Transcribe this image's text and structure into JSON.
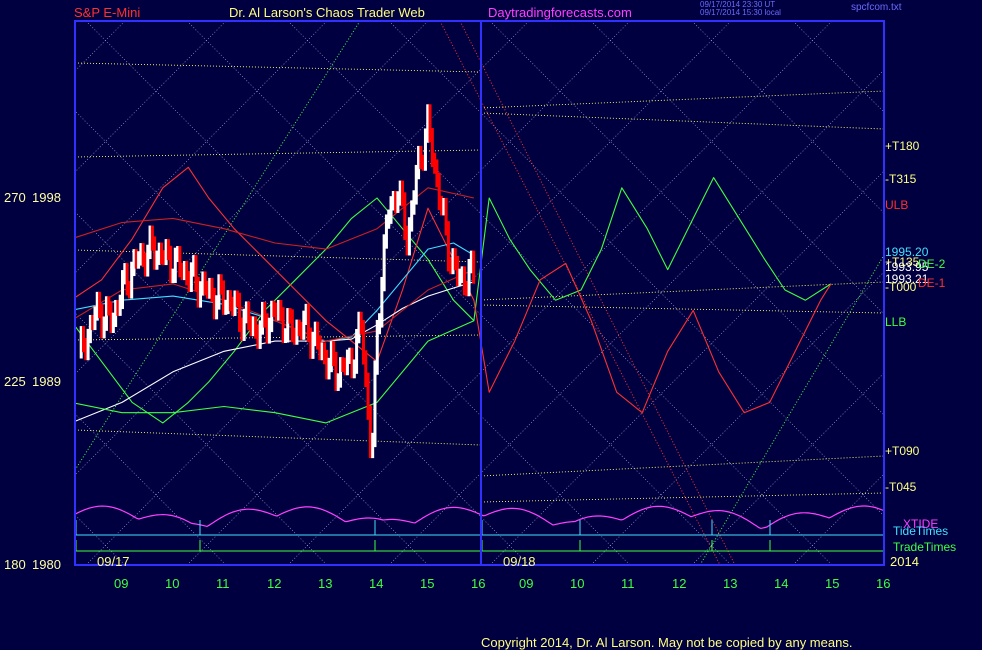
{
  "header": {
    "instrument": "S&P E-Mini",
    "site": "Dr. Al Larson's Chaos Trader Web",
    "link": "Daytradingforecasts.com",
    "ts1": "09/17/2014 23:30 UT",
    "ts2": "09/17/2014 15:30 local",
    "file": "spcfcom.txt"
  },
  "copyright": "Copyright 2014, Dr. Al Larson. May not be copied by any means.",
  "colors": {
    "background": "#000040",
    "frame": "#3030ff",
    "price_up": "#ffffff",
    "price_down": "#ff0000"
  },
  "chart_data": {
    "type": "line",
    "title": "S&P E-Mini",
    "y_axis_labels": [
      {
        "deg": "270",
        "price": "1998"
      },
      {
        "deg": "225",
        "price": "1989"
      },
      {
        "deg": "180",
        "price": "1980"
      }
    ],
    "x_tick_labels_day1": [
      "09",
      "10",
      "11",
      "12",
      "13",
      "14",
      "15",
      "16"
    ],
    "x_tick_labels_day2": [
      "09",
      "10",
      "11",
      "12",
      "13",
      "14",
      "15",
      "16"
    ],
    "date_labels": {
      "day1": "09/17",
      "day2": "09/18",
      "year": "2014"
    },
    "level_labels": [
      {
        "text": "+T180",
        "color": "#ffff80",
        "price": 2000.5
      },
      {
        "text": "-T315",
        "color": "#ffff80",
        "price": 1998.9
      },
      {
        "text": "ULB",
        "color": "#ff3030",
        "price": 1997.6
      },
      {
        "text": "1995.20",
        "color": "#40e0ff",
        "price": 1995.3
      },
      {
        "text": "+T135",
        "color": "#ffff80",
        "price": 1994.8
      },
      {
        "text": "1993.95",
        "color": "#ffffff",
        "price": 1994.6
      },
      {
        "text": "DE-2",
        "color": "#40ff40",
        "price": 1994.7
      },
      {
        "text": "1993.21",
        "color": "#ffffff",
        "price": 1994.0
      },
      {
        "text": "DE-1",
        "color": "#ff3030",
        "price": 1993.8
      },
      {
        "text": "-T000",
        "color": "#ffff80",
        "price": 1993.6
      },
      {
        "text": "LLB",
        "color": "#40ff40",
        "price": 1991.9
      },
      {
        "text": "+T090",
        "color": "#ffff80",
        "price": 1985.6
      },
      {
        "text": "-T045",
        "color": "#ffff80",
        "price": 1983.8
      }
    ],
    "legend": [
      "XTIDE",
      "TideTimes",
      "TradeTimes"
    ],
    "series": [
      {
        "name": "Price",
        "color": "#ffffff",
        "x": [
          8.2,
          8.5,
          8.8,
          9.0,
          9.3,
          9.6,
          9.9,
          10.2,
          10.5,
          10.8,
          11.1,
          11.4,
          11.7,
          12.0,
          12.3,
          12.6,
          12.9,
          13.2,
          13.5,
          13.7,
          13.9,
          14.0,
          14.2,
          14.4,
          14.6,
          14.8,
          15.0,
          15.2,
          15.4,
          15.6,
          15.9
        ],
        "y": [
          1990.5,
          1992.5,
          1992.0,
          1993.5,
          1995.0,
          1995.5,
          1995.0,
          1994.5,
          1993.8,
          1993.2,
          1993.0,
          1992.0,
          1991.5,
          1992.5,
          1991.5,
          1991.8,
          1990.5,
          1989.5,
          1990.0,
          1991.8,
          1985.0,
          1991.5,
          1997.0,
          1998.5,
          1996.0,
          1999.5,
          2001.5,
          1998.5,
          1995.5,
          1994.0,
          1994.3
        ]
      },
      {
        "name": "DE-2",
        "color": "#40ff40",
        "x": [
          8.0,
          8.6,
          9.2,
          9.8,
          10.3,
          10.7,
          11.2,
          11.8,
          12.4,
          13.0,
          13.5,
          14.0,
          14.5,
          15.0,
          15.5,
          15.9,
          16.2,
          16.6,
          17.0,
          17.5,
          18.0,
          18.4,
          18.8,
          19.3,
          19.7,
          20.2,
          20.6,
          21.1,
          21.6,
          22.0,
          22.4,
          22.9
        ],
        "y": [
          1992.0,
          1990.0,
          1988.0,
          1987.0,
          1988.0,
          1989.0,
          1990.5,
          1992.5,
          1994.0,
          1995.5,
          1997.0,
          1998.0,
          1996.5,
          1995.0,
          1993.0,
          1992.0,
          1998.0,
          1996.0,
          1994.5,
          1993.0,
          1993.5,
          1995.5,
          1998.5,
          1996.5,
          1994.5,
          1997.0,
          1999.0,
          1997.0,
          1995.0,
          1993.5,
          1993.0,
          1993.8
        ]
      },
      {
        "name": "DE-1",
        "color": "#ff3030",
        "x": [
          8.0,
          8.6,
          9.2,
          9.8,
          10.3,
          10.7,
          11.2,
          11.8,
          12.4,
          13.0,
          13.5,
          14.0,
          14.5,
          15.0,
          15.5,
          15.9,
          16.2,
          16.7,
          17.2,
          17.7,
          18.2,
          18.7,
          19.2,
          19.7,
          20.2,
          20.7,
          21.2,
          21.7,
          22.2,
          22.7,
          22.9
        ],
        "y": [
          1993.0,
          1994.0,
          1996.0,
          1998.5,
          1999.5,
          1998.0,
          1996.5,
          1995.0,
          1993.5,
          1992.0,
          1991.0,
          1990.0,
          1993.5,
          1997.5,
          1995.0,
          1993.0,
          1988.5,
          1991.0,
          1994.0,
          1994.8,
          1992.0,
          1988.5,
          1987.5,
          1990.5,
          1992.5,
          1989.5,
          1987.5,
          1988.0,
          1990.5,
          1993.0,
          1993.8
        ]
      },
      {
        "name": "Avg-fast",
        "color": "#40e0ff",
        "x": [
          8.0,
          9.0,
          10.0,
          11.0,
          12.0,
          13.0,
          13.5,
          14.0,
          14.5,
          15.0,
          15.5,
          15.9
        ],
        "y": [
          1992.5,
          1993.0,
          1993.2,
          1992.8,
          1992.0,
          1991.0,
          1991.2,
          1992.5,
          1994.0,
          1995.5,
          1995.8,
          1995.2
        ]
      },
      {
        "name": "Avg-slow",
        "color": "#ffffff",
        "x": [
          8.0,
          9.0,
          10.0,
          11.0,
          12.0,
          13.0,
          13.5,
          14.0,
          14.5,
          15.0,
          15.5,
          15.9
        ],
        "y": [
          1987.0,
          1988.0,
          1989.5,
          1990.5,
          1991.0,
          1991.0,
          1991.1,
          1991.8,
          1992.6,
          1993.2,
          1993.6,
          1993.9
        ]
      },
      {
        "name": "ULB-upper",
        "color": "#cc2020",
        "x": [
          8.0,
          9.0,
          10.0,
          11.0,
          12.0,
          13.0,
          14.0,
          15.0,
          15.9
        ],
        "y": [
          1996.0,
          1996.8,
          1997.0,
          1996.5,
          1995.8,
          1995.5,
          1996.5,
          1998.5,
          1998.0
        ]
      },
      {
        "name": "ULB-lower",
        "color": "#cc2020",
        "x": [
          8.0,
          9.0,
          10.0,
          11.0,
          12.0,
          13.0,
          14.0,
          15.0,
          15.9
        ],
        "y": [
          1992.0,
          1993.5,
          1993.8,
          1993.0,
          1992.0,
          1991.0,
          1991.5,
          1993.5,
          1994.5
        ]
      },
      {
        "name": "LLB",
        "color": "#40ff40",
        "x": [
          8.0,
          9.0,
          10.0,
          11.0,
          12.0,
          13.0,
          14.0,
          15.0,
          15.9
        ],
        "y": [
          1988.0,
          1987.5,
          1987.5,
          1987.8,
          1987.5,
          1987.0,
          1988.0,
          1991.0,
          1992.0
        ]
      }
    ]
  }
}
